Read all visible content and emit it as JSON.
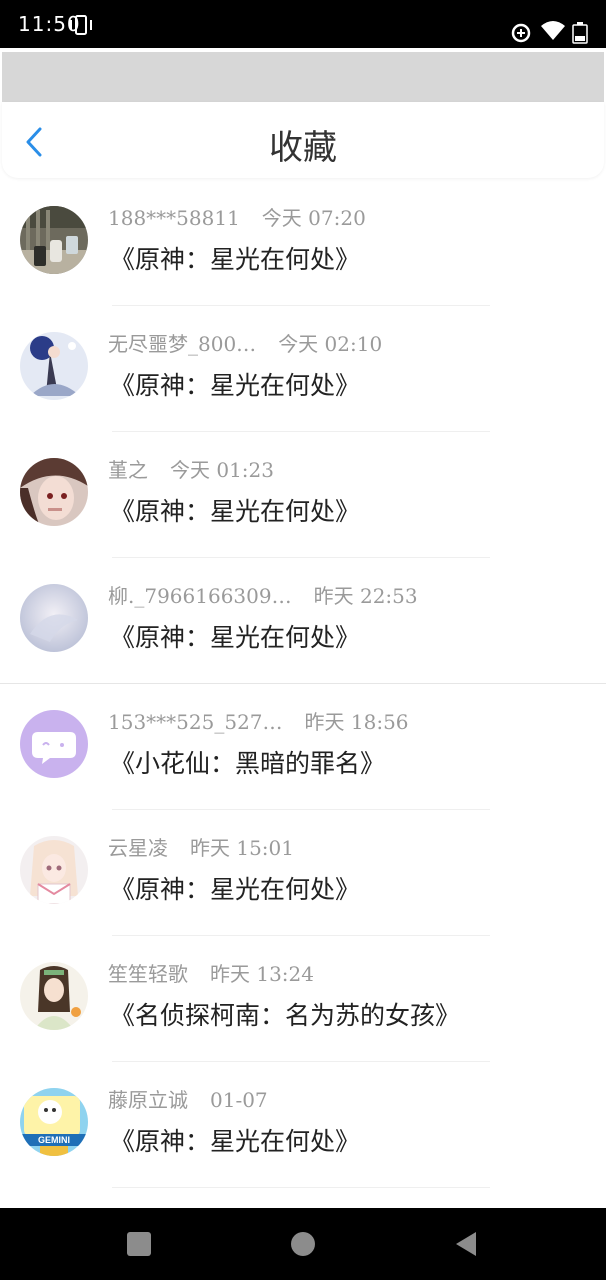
{
  "status_bar": {
    "time": "11:50"
  },
  "header": {
    "title": "收藏",
    "back_icon": "chevron-left-icon"
  },
  "colors": {
    "accent": "#2a8ee8",
    "meta_text": "#9a9a9a",
    "title_text": "#222222"
  },
  "favorites": [
    {
      "user": "188***58811",
      "time": "今天 07:20",
      "title": "《原神：星光在何处》"
    },
    {
      "user": "无尽噩梦_800…",
      "time": "今天 02:10",
      "title": "《原神：星光在何处》"
    },
    {
      "user": "堇之",
      "time": "今天 01:23",
      "title": "《原神：星光在何处》"
    },
    {
      "user": "柳._7966166309…",
      "time": "昨天 22:53",
      "title": "《原神：星光在何处》"
    },
    {
      "user": "153***525_527…",
      "time": "昨天 18:56",
      "title": "《小花仙：黑暗的罪名》"
    },
    {
      "user": "云星凌",
      "time": "昨天 15:01",
      "title": "《原神：星光在何处》"
    },
    {
      "user": "笙笙轻歌",
      "time": "昨天 13:24",
      "title": "《名侦探柯南：名为苏的女孩》"
    },
    {
      "user": "藤原立诚",
      "time": "01-07",
      "title": "《原神：星光在何处》"
    }
  ],
  "avatar_badge_text": "GEMINI"
}
